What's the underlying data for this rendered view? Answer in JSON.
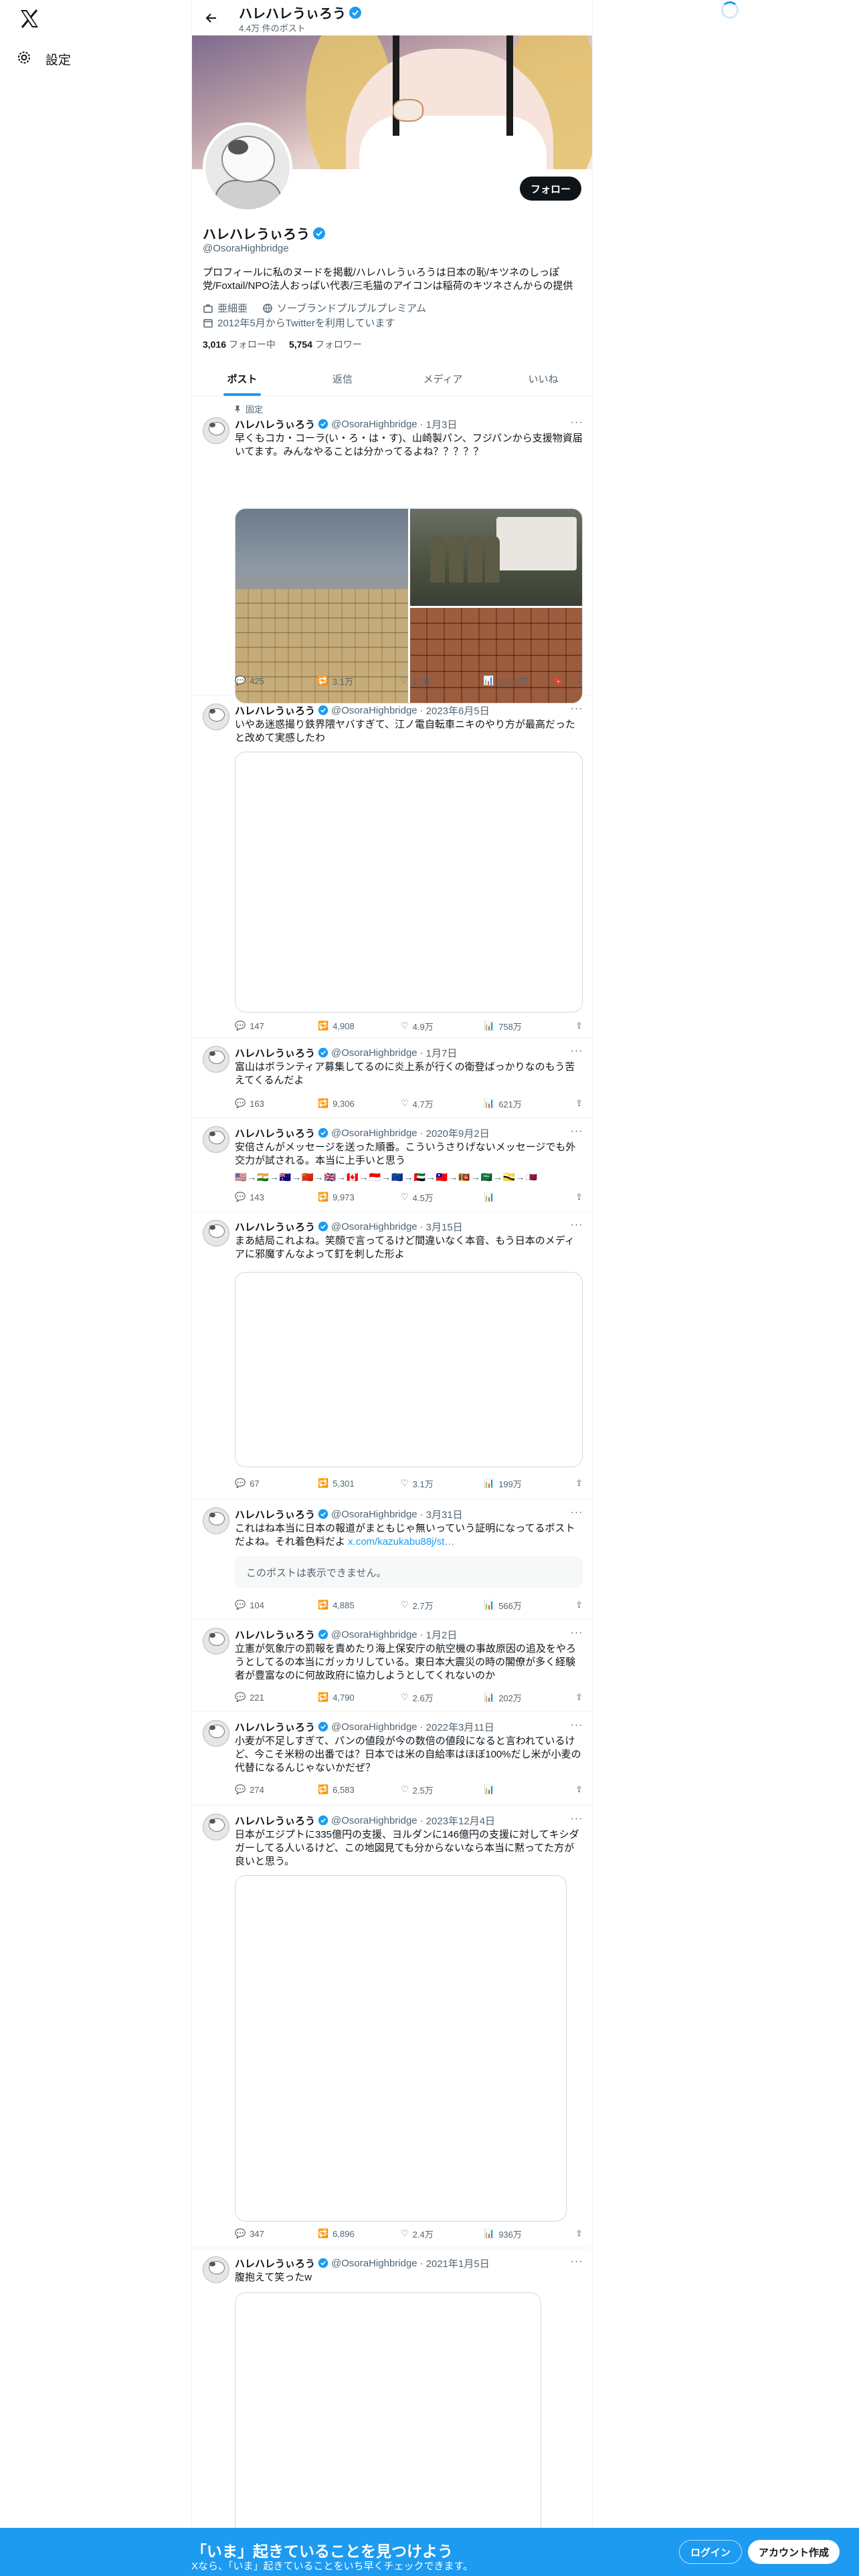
{
  "nav": {
    "settings_label": "設定"
  },
  "header": {
    "name": "ハレハレうぃろう",
    "post_count": "4.4万 件のポスト"
  },
  "profile": {
    "name": "ハレハレうぃろう",
    "handle": "@OsoraHighbridge",
    "follow_label": "フォロー",
    "bio": "プロフィールに私のヌードを掲載/ハレハレうぃろうは日本の恥/キツネのしっぽ党/Foxtail/NPO法人おっぱい代表/三毛猫のアイコンは稲荷のキツネさんからの提供",
    "job": "亜細亜",
    "link": "ソーブランドプルプルプレミアム",
    "joined": "2012年5月からTwitterを利用しています",
    "following_count": "3,016",
    "following_label": "フォロー中",
    "followers_count": "5,754",
    "followers_label": "フォロワー"
  },
  "tabs": [
    "ポスト",
    "返信",
    "メディア",
    "いいね"
  ],
  "pinned_label": "固定",
  "tweets": [
    {
      "name": "ハレハレうぃろう",
      "handle": "@OsoraHighbridge",
      "date": "1月3日",
      "text": "早くもコカ・コーラ(い・ろ・は・す)、山崎製パン、フジパンから支援物資届いてます。みんなやることは分かってるよね？？？？？",
      "reply": "425",
      "retweet": "3.1万",
      "like": "17万",
      "views": "2,245万"
    },
    {
      "name": "ハレハレうぃろう",
      "handle": "@OsoraHighbridge",
      "date": "2023年6月5日",
      "text": "いやあ迷惑撮り鉄界隈ヤバすぎて、江ノ電自転車ニキのやり方が最高だったと改めて実感したわ",
      "reply": "147",
      "retweet": "4,908",
      "like": "4.9万",
      "views": "758万"
    },
    {
      "name": "ハレハレうぃろう",
      "handle": "@OsoraHighbridge",
      "date": "1月7日",
      "text": "富山はボランティア募集してるのに炎上系が行くの衛登ばっかりなのもう苦えてくるんだよ",
      "reply": "163",
      "retweet": "9,306",
      "like": "4.7万",
      "views": "621万"
    },
    {
      "name": "ハレハレうぃろう",
      "handle": "@OsoraHighbridge",
      "date": "2020年9月2日",
      "text": "安倍さんがメッセージを送った順番。こういうさりげないメッセージでも外交力が試される。本当に上手いと思う",
      "flags": "🇺🇸→🇮🇳→🇦🇺→🇨🇳→🇬🇧→🇨🇦→🇮🇩→🇪🇺→🇦🇪→🇹🇼→🇱🇰→🇸🇦→🇧🇳→🇶🇦",
      "reply": "143",
      "retweet": "9,973",
      "like": "4.5万",
      "views": ""
    },
    {
      "name": "ハレハレうぃろう",
      "handle": "@OsoraHighbridge",
      "date": "3月15日",
      "text": "まあ結局これよね。笑顔で言ってるけど間違いなく本音、もう日本のメディアに邪魔すんなよって釘を刺した形よ",
      "reply": "67",
      "retweet": "5,301",
      "like": "3.1万",
      "views": "199万"
    },
    {
      "name": "ハレハレうぃろう",
      "handle": "@OsoraHighbridge",
      "date": "3月31日",
      "text": "これはね本当に日本の報道がまともじゃ無いっていう証明になってるポストだよね。それ着色料だよ ",
      "link": "x.com/kazukabu88j/st…",
      "quote": "このポストは表示できません。",
      "reply": "104",
      "retweet": "4,885",
      "like": "2.7万",
      "views": "566万"
    },
    {
      "name": "ハレハレうぃろう",
      "handle": "@OsoraHighbridge",
      "date": "1月2日",
      "text": "立憲が気象庁の罰報を責めたり海上保安庁の航空機の事故原因の追及をやろうとしてるの本当にガッカリしている。東日本大震災の時の閣僚が多く経験者が豊富なのに何故政府に協力しようとしてくれないのか",
      "reply": "221",
      "retweet": "4,790",
      "like": "2.6万",
      "views": "202万"
    },
    {
      "name": "ハレハレうぃろう",
      "handle": "@OsoraHighbridge",
      "date": "2022年3月11日",
      "text": "小麦が不足しすぎて、パンの値段が今の数倍の値段になると言われているけど、今こそ米粉の出番では？日本では米の自給率はほぼ100%だし米が小麦の代替になるんじゃないかだぜ？",
      "reply": "274",
      "retweet": "6,583",
      "like": "2.5万",
      "views": ""
    },
    {
      "name": "ハレハレうぃろう",
      "handle": "@OsoraHighbridge",
      "date": "2023年12月4日",
      "text": "日本がエジプトに335億円の支援、ヨルダンに146億円の支援に対してキシダガーしてる人いるけど、この地図見ても分からないなら本当に黙ってた方が良いと思う。",
      "reply": "347",
      "retweet": "6,896",
      "like": "2.4万",
      "views": "936万"
    },
    {
      "name": "ハレハレうぃろう",
      "handle": "@OsoraHighbridge",
      "date": "2021年1月5日",
      "text": "腹抱えて笑ったw",
      "reply": "",
      "retweet": "",
      "like": "",
      "views": ""
    }
  ],
  "bottom": {
    "headline": "「いま」起きていることを見つけよう",
    "subline": "Xなら、「いま」起きていることをいち早くチェックできます。",
    "login_label": "ログイン",
    "signup_label": "アカウント作成"
  }
}
